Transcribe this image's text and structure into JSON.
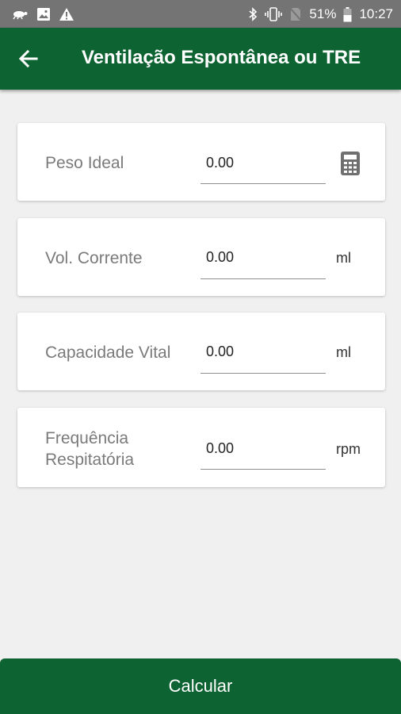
{
  "status_bar": {
    "battery": "51%",
    "time": "10:27",
    "icons": [
      "tortoise-icon",
      "image-icon",
      "warning-icon",
      "bluetooth-icon",
      "vibrate-icon",
      "no-sim-icon",
      "battery-icon"
    ]
  },
  "app_bar": {
    "title": "Ventilação Espontânea ou TRE",
    "back_icon": "arrow-left-icon",
    "color": "#0d6331"
  },
  "fields": [
    {
      "label": "Peso Ideal",
      "value": "0.00",
      "unit": "",
      "icon": "calculator-icon"
    },
    {
      "label": "Vol. Corrente",
      "value": "0.00",
      "unit": "ml"
    },
    {
      "label": "Capacidade Vital",
      "value": "0.00",
      "unit": "ml"
    },
    {
      "label_line1": "Frequência",
      "label_line2": "Respitatória",
      "value": "0.00",
      "unit": "rpm"
    }
  ],
  "calculate_button": {
    "label": "Calcular"
  }
}
